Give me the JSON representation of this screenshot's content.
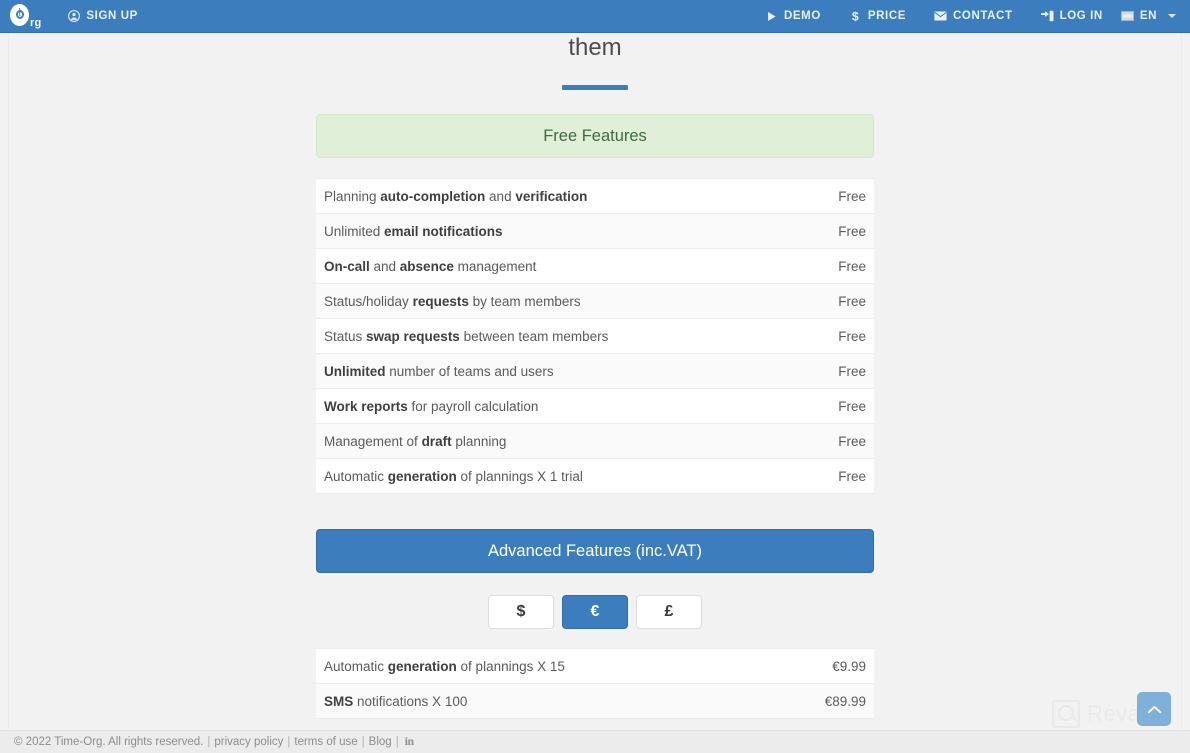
{
  "navbar": {
    "logo": {
      "main": "O",
      "suffix": "rg",
      "name": "Time-Org"
    },
    "left_items": [
      {
        "label": "SIGN UP",
        "icon": "user-circle-icon"
      }
    ],
    "right_items": [
      {
        "label": "DEMO",
        "icon": "play-icon"
      },
      {
        "label": "PRICE",
        "icon": "dollar-icon"
      },
      {
        "label": "CONTACT",
        "icon": "envelope-icon"
      },
      {
        "label": "LOG IN",
        "icon": "login-icon"
      }
    ],
    "language": {
      "label": "EN",
      "icon": "flag-icon",
      "caret": "chevron-down-icon"
    },
    "background_color": "#3b7dbd"
  },
  "main": {
    "heading_tail": "them",
    "free_panel": {
      "title": "Free Features",
      "background_color": "#e0efd7",
      "text_color": "#3f6b42",
      "rows": [
        {
          "prefix": "Planning ",
          "bold": "auto-completion",
          "mid": " and ",
          "bold2": "verification",
          "suffix": "",
          "value": "Free"
        },
        {
          "prefix": "Unlimited ",
          "bold": "email notifications",
          "mid": "",
          "bold2": "",
          "suffix": "",
          "value": "Free"
        },
        {
          "prefix": "",
          "bold": "On-call",
          "mid": " and ",
          "bold2": "absence",
          "suffix": " management",
          "value": "Free"
        },
        {
          "prefix": "Status/holiday ",
          "bold": "requests",
          "mid": " by team members",
          "bold2": "",
          "suffix": "",
          "value": "Free"
        },
        {
          "prefix": "Status ",
          "bold": "swap requests",
          "mid": " between team members",
          "bold2": "",
          "suffix": "",
          "value": "Free"
        },
        {
          "prefix": "",
          "bold": "Unlimited",
          "mid": " number of teams and users",
          "bold2": "",
          "suffix": "",
          "value": "Free"
        },
        {
          "prefix": "",
          "bold": "Work reports",
          "mid": " for payroll calculation",
          "bold2": "",
          "suffix": "",
          "value": "Free"
        },
        {
          "prefix": "Management of ",
          "bold": "draft",
          "mid": " planning",
          "bold2": "",
          "suffix": "",
          "value": "Free"
        },
        {
          "prefix": "Automatic ",
          "bold": "generation",
          "mid": " of plannings X 1 trial",
          "bold2": "",
          "suffix": "",
          "value": "Free"
        }
      ]
    },
    "advanced_panel": {
      "title": "Advanced Features (inc.VAT)",
      "background_color": "#3b7dbd",
      "currencies": [
        {
          "symbol": "$",
          "code": "USD",
          "active": false
        },
        {
          "symbol": "€",
          "code": "EUR",
          "active": true
        },
        {
          "symbol": "£",
          "code": "GBP",
          "active": false
        }
      ],
      "rows": [
        {
          "prefix": "Automatic ",
          "bold": "generation",
          "mid": " of plannings X 15",
          "bold2": "",
          "suffix": "",
          "value": "€9.99"
        },
        {
          "prefix": "",
          "bold": "SMS",
          "mid": " notifications X 100",
          "bold2": "",
          "suffix": "",
          "value": "€89.99"
        }
      ]
    }
  },
  "footer": {
    "copyright": "© 2022 Time-Org. All rights reserved.",
    "links": [
      "privacy policy",
      "terms of use",
      "Blog"
    ],
    "social": {
      "label": "in",
      "name": "linkedin-icon"
    }
  },
  "overlays": {
    "watermark_text": "Revain",
    "scroll_top_label": "scroll to top"
  }
}
